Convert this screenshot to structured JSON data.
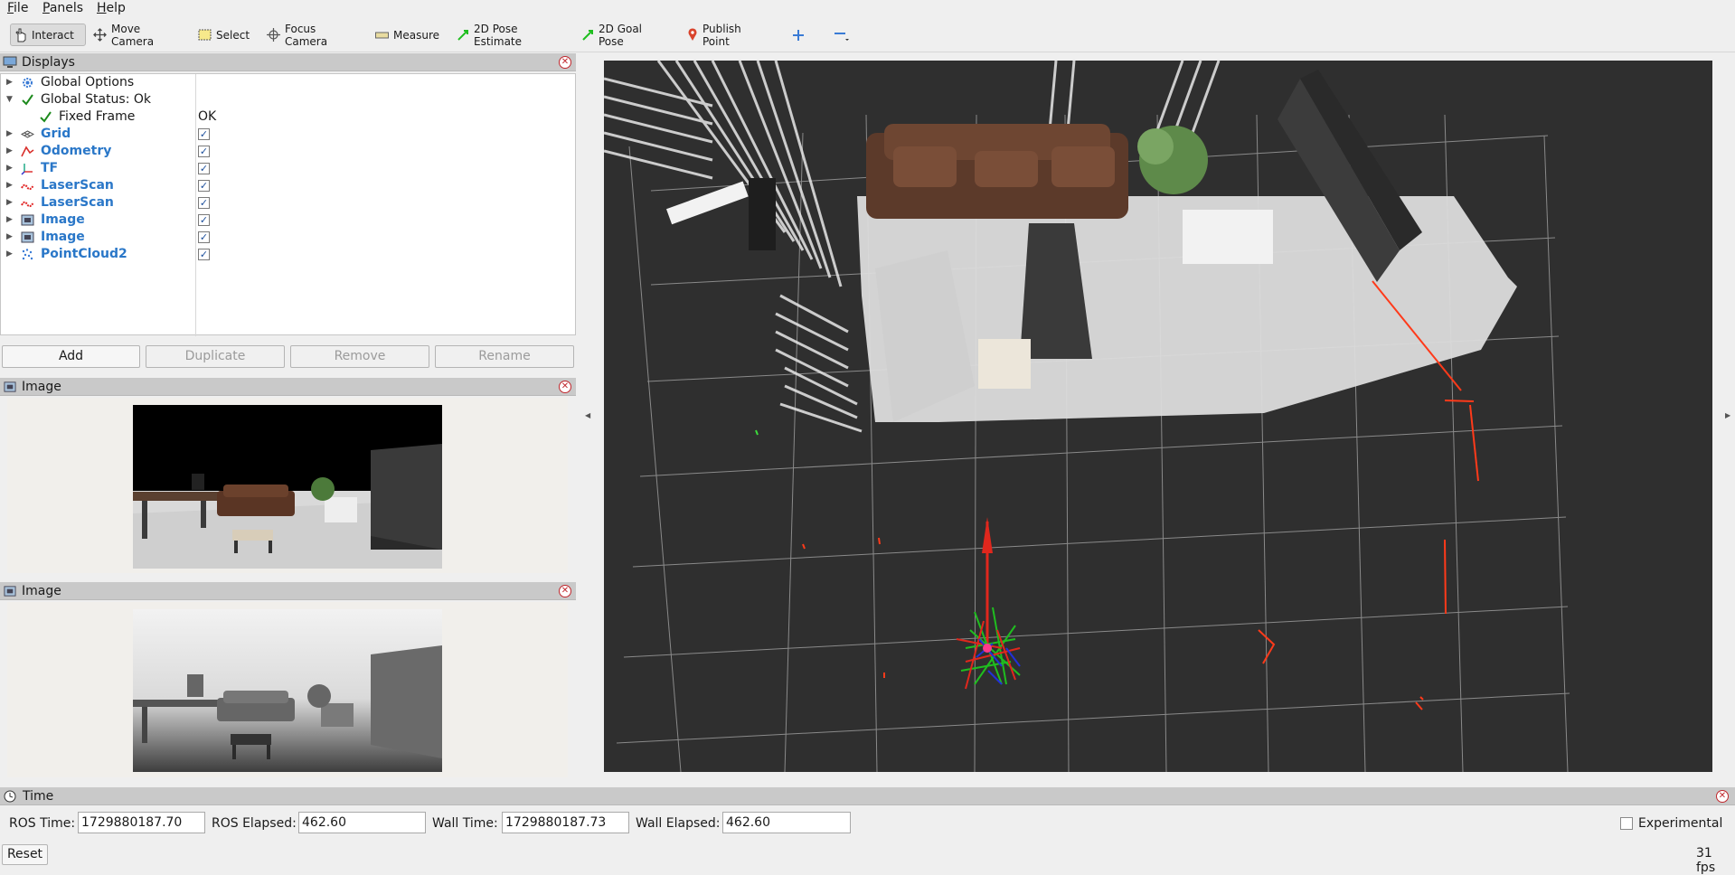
{
  "menu": {
    "items": [
      "File",
      "Panels",
      "Help"
    ]
  },
  "toolbar": {
    "tools": [
      "Interact",
      "Move Camera",
      "Select",
      "Focus Camera",
      "Measure",
      "2D Pose Estimate",
      "2D Goal Pose",
      "Publish Point"
    ]
  },
  "displays": {
    "title": "Displays",
    "items": [
      {
        "label": "Global Options",
        "icon": "gear-icon"
      },
      {
        "label": "Global Status: Ok",
        "icon": "checkmark-icon",
        "status_color": "#1d8a1d"
      },
      {
        "label": "Fixed Frame",
        "value": "OK",
        "icon": "checkmark-icon"
      },
      {
        "label": "Grid",
        "icon": "grid-icon",
        "checked": true
      },
      {
        "label": "Odometry",
        "icon": "odometry-icon",
        "checked": true
      },
      {
        "label": "TF",
        "icon": "tf-axes-icon",
        "checked": true
      },
      {
        "label": "LaserScan",
        "icon": "laserscan-icon",
        "checked": true
      },
      {
        "label": "LaserScan",
        "icon": "laserscan-icon",
        "checked": true
      },
      {
        "label": "Image",
        "icon": "image-icon",
        "checked": true
      },
      {
        "label": "Image",
        "icon": "image-icon",
        "checked": true
      },
      {
        "label": "PointCloud2",
        "icon": "pointcloud-icon",
        "checked": true
      }
    ],
    "buttons": {
      "add": "Add",
      "duplicate": "Duplicate",
      "remove": "Remove",
      "rename": "Rename"
    }
  },
  "image_panels": [
    {
      "title": "Image"
    },
    {
      "title": "Image"
    }
  ],
  "time": {
    "title": "Time",
    "ros_time_label": "ROS Time:",
    "ros_time": "1729880187.70",
    "ros_elapsed_label": "ROS Elapsed:",
    "ros_elapsed": "462.60",
    "wall_time_label": "Wall Time:",
    "wall_time": "1729880187.73",
    "wall_elapsed_label": "Wall Elapsed:",
    "wall_elapsed": "462.60",
    "experimental_label": "Experimental",
    "reset_label": "Reset",
    "fps": "31 fps"
  },
  "colors": {
    "accent_blue": "#2a77c8",
    "close_red": "#c0272d",
    "laser_red": "#ff3a1a",
    "viewport_bg": "#2f2f2f"
  }
}
